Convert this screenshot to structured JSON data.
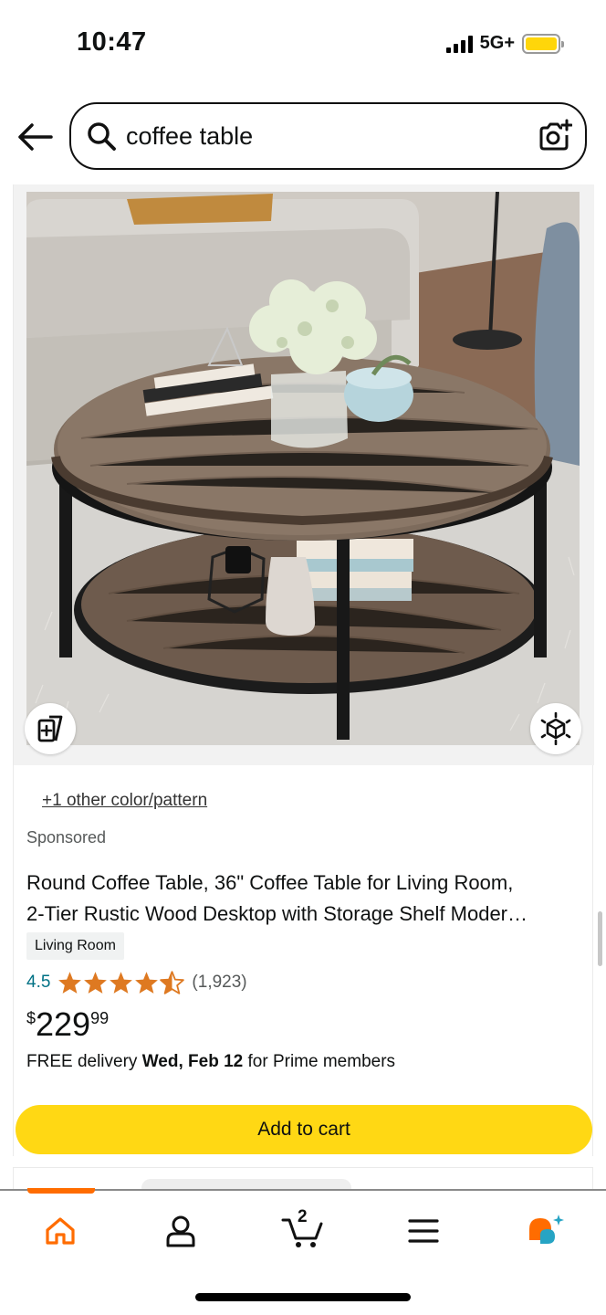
{
  "status_bar": {
    "time": "10:47",
    "network": "5G+",
    "battery_color": "#ffd60a"
  },
  "search": {
    "query": "coffee table",
    "back_icon": "arrow-left-icon",
    "search_icon": "magnifier-icon",
    "camera_icon": "camera-icon"
  },
  "product": {
    "color_options": "+1 other color/pattern",
    "sponsored": "Sponsored",
    "title_line1": "Round Coffee Table, 36\" Coffee Table for Living Room,",
    "title_line2": "2-Tier Rustic Wood Desktop with Storage Shelf Moder…",
    "badge": "Living Room",
    "rating": "4.5",
    "review_count": "(1,923)",
    "price_symbol": "$",
    "price_whole": "229",
    "price_fraction": "99",
    "delivery_prefix": "FREE delivery ",
    "delivery_date": "Wed, Feb 12",
    "delivery_suffix": " for Prime members",
    "add_to_cart": "Add to cart",
    "star_color": "#de7921",
    "button_color": "#ffd814"
  },
  "bottom_nav": {
    "items": [
      "home-icon",
      "account-icon",
      "cart-icon",
      "menu-icon",
      "rufus-icon"
    ],
    "cart_count": "2",
    "active_color": "#ff6c00"
  }
}
